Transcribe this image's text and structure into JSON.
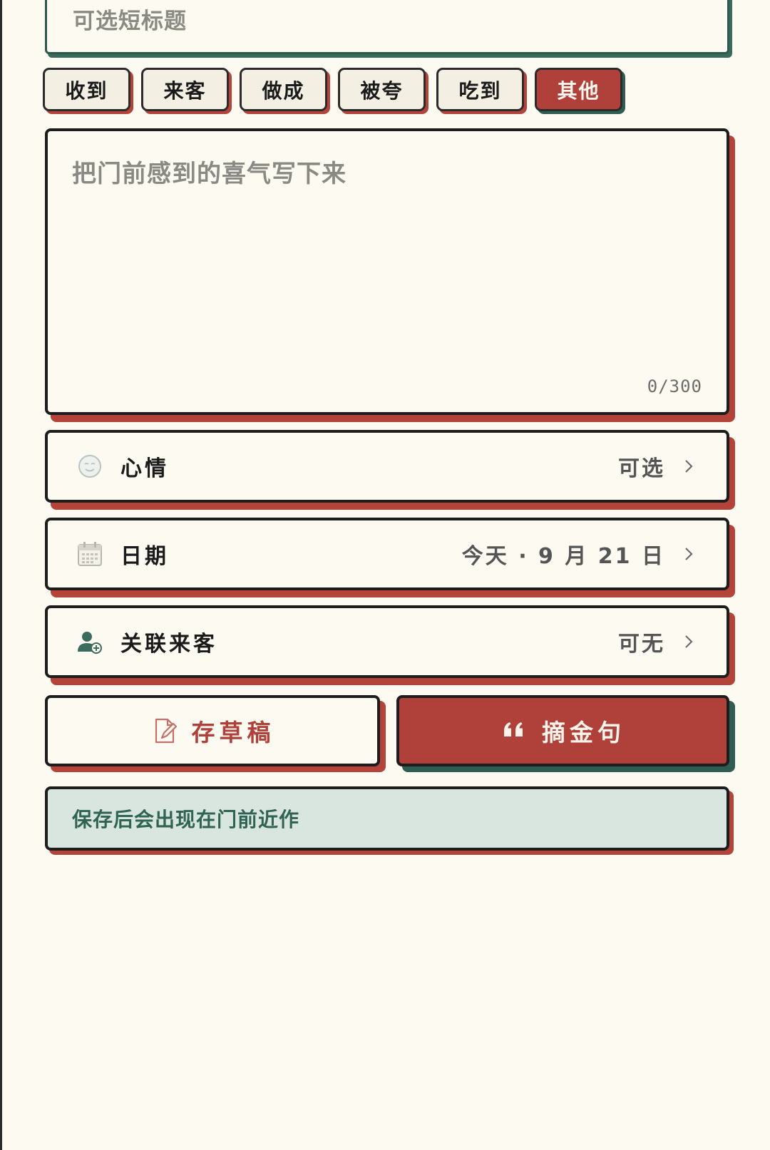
{
  "title_input": {
    "placeholder": "可选短标题"
  },
  "categories": [
    {
      "label": "收到",
      "active": false
    },
    {
      "label": "来客",
      "active": false
    },
    {
      "label": "做成",
      "active": false
    },
    {
      "label": "被夸",
      "active": false
    },
    {
      "label": "吃到",
      "active": false
    },
    {
      "label": "其他",
      "active": true
    }
  ],
  "note": {
    "placeholder": "把门前感到的喜气写下来",
    "counter": "0/300"
  },
  "fields": {
    "mood": {
      "icon": "smile-icon",
      "label": "心情",
      "value": "可选"
    },
    "date": {
      "icon": "calendar-icon",
      "label": "日期",
      "value": "今天 · 9 月 21 日"
    },
    "guest": {
      "icon": "add-user-icon",
      "label": "关联来客",
      "value": "可无"
    }
  },
  "actions": {
    "draft": {
      "icon": "edit-document-icon",
      "label": "存草稿"
    },
    "quote": {
      "icon": "quote-icon",
      "label": "摘金句"
    }
  },
  "notice": {
    "text": "保存后会出现在门前近作"
  },
  "colors": {
    "background": "#fdfbf1",
    "accent_red": "#b0413a",
    "accent_green": "#2f5d51",
    "notice_bg": "#d9e6e0"
  }
}
